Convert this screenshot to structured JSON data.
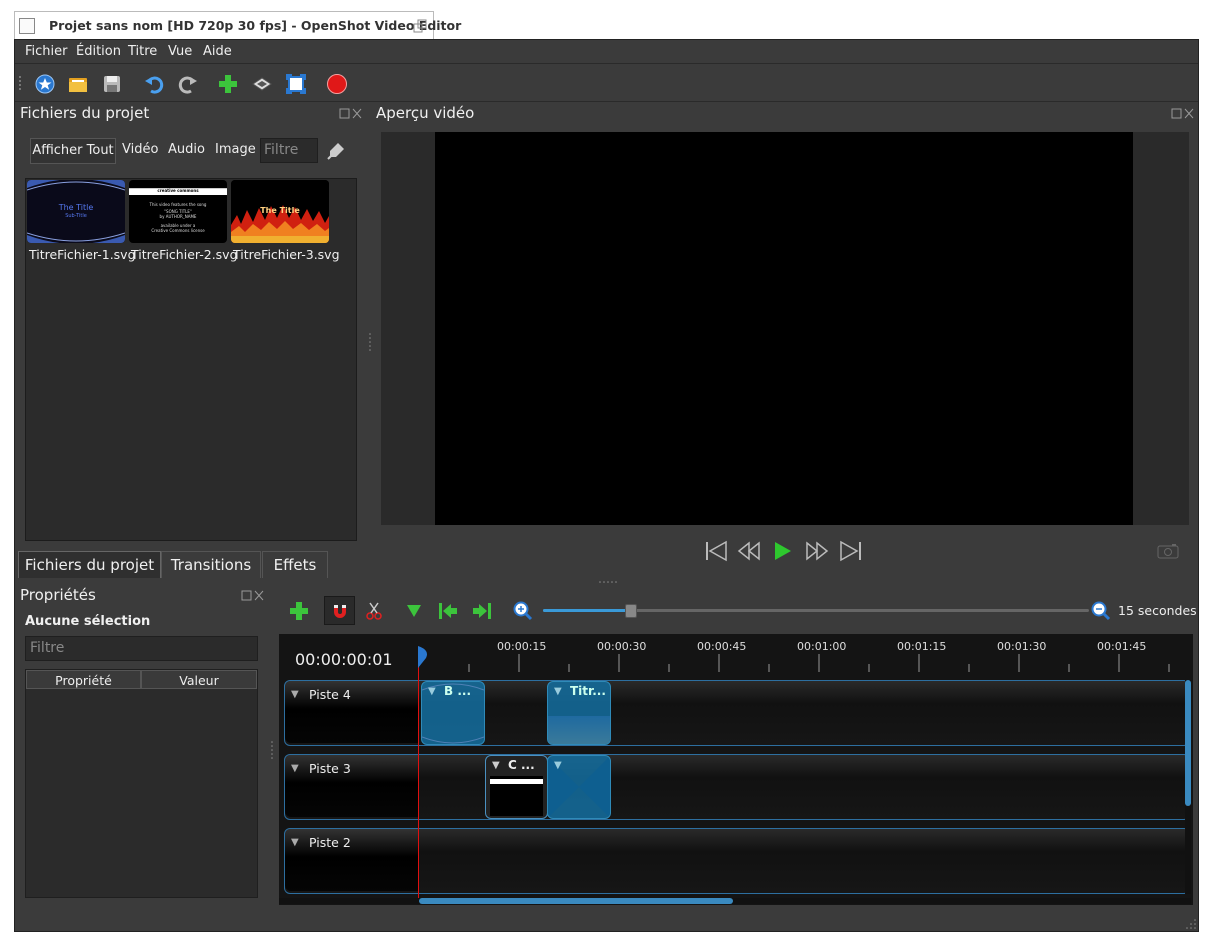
{
  "window": {
    "title": "Projet sans nom [HD 720p 30 fps] - OpenShot Video Editor"
  },
  "menu": [
    {
      "label": "Fichier"
    },
    {
      "label": "Édition"
    },
    {
      "label": "Titre"
    },
    {
      "label": "Vue"
    },
    {
      "label": "Aide"
    }
  ],
  "toolbar": {
    "icons": [
      "new-project-icon",
      "open-project-icon",
      "save-project-icon",
      "undo-icon",
      "redo-icon",
      "import-files-icon",
      "choose-profile-icon",
      "fullscreen-icon",
      "export-video-icon"
    ]
  },
  "project_files": {
    "title": "Fichiers du projet",
    "filters": [
      "Afficher Tout",
      "Vidéo",
      "Audio",
      "Image"
    ],
    "filter_placeholder": "Filtre",
    "files": [
      {
        "name": "TitreFichier-1.svg",
        "thumb_title": "The Title",
        "thumb_sub": "Sub-Title"
      },
      {
        "name": "TitreFichier-2.svg",
        "thumb_lines": [
          "creative commons",
          "This video features the song",
          "\"SONG TITLE\"",
          "by AUTHOR_NAME",
          "available under a",
          "Creative Commons license"
        ]
      },
      {
        "name": "TitreFichier-3.svg",
        "thumb_title": "The Title"
      }
    ]
  },
  "tabs": [
    "Fichiers du projet",
    "Transitions",
    "Effets"
  ],
  "preview": {
    "title": "Aperçu vidéo"
  },
  "properties": {
    "title": "Propriétés",
    "selection": "Aucune sélection",
    "filter_placeholder": "Filtre",
    "col_property": "Propriété",
    "col_value": "Valeur"
  },
  "timeline": {
    "zoom_label": "15 secondes",
    "zoom_level": 0.16,
    "current_time": "00:00:00:01",
    "ruler": [
      "00:00:15",
      "00:00:30",
      "00:00:45",
      "00:01:00",
      "00:01:15",
      "00:01:30",
      "00:01:45"
    ],
    "tracks": [
      {
        "name": "Piste 4",
        "clips": [
          {
            "title": "B ..."
          },
          {
            "title": "Titr..."
          }
        ]
      },
      {
        "name": "Piste 3",
        "clips": [
          {
            "title": "C ..."
          },
          {
            "title": ""
          }
        ]
      },
      {
        "name": "Piste 2",
        "clips": []
      }
    ]
  },
  "colors": {
    "accent": "#2f8ab8",
    "playhead": "#e01010",
    "background": "#3b3b3b"
  }
}
